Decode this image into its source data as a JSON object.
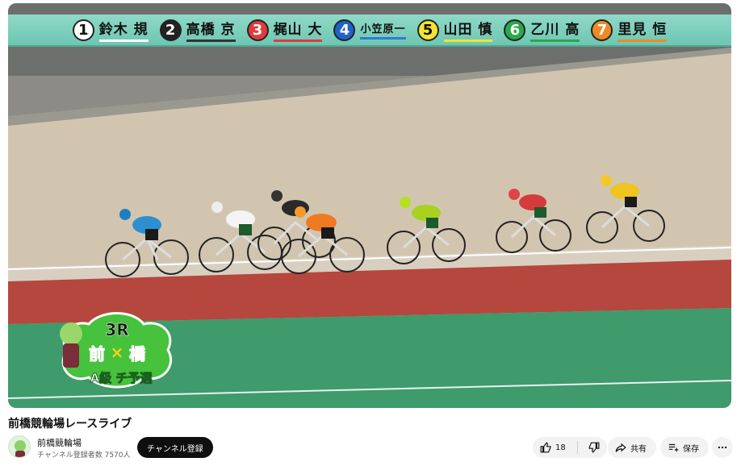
{
  "video": {
    "riders": [
      {
        "number": "1",
        "name": "鈴木 規",
        "bg": "#ffffff",
        "fg": "#111111",
        "line": "#ffffff"
      },
      {
        "number": "2",
        "name": "高橋 京",
        "bg": "#222222",
        "fg": "#ffffff",
        "line": "#333333"
      },
      {
        "number": "3",
        "name": "梶山 大",
        "bg": "#e23a3a",
        "fg": "#ffffff",
        "line": "#e23a3a"
      },
      {
        "number": "4",
        "name": "小笠原一",
        "bg": "#1f62c9",
        "fg": "#ffffff",
        "line": "#2f7ad8"
      },
      {
        "number": "5",
        "name": "山田 慎",
        "bg": "#f4e431",
        "fg": "#111111",
        "line": "#f4e431"
      },
      {
        "number": "6",
        "name": "乙川 高",
        "bg": "#2aa84a",
        "fg": "#ffffff",
        "line": "#2aa84a"
      },
      {
        "number": "7",
        "name": "里見 恒",
        "bg": "#f08a24",
        "fg": "#ffffff",
        "line": "#f08a24"
      }
    ],
    "badge": {
      "race": "3R",
      "venue_left": "前",
      "venue_right": "橋",
      "class_text": "A級 チ予選"
    }
  },
  "meta": {
    "title": "前橋競輪場レースライブ",
    "channel_name": "前橋競輪場",
    "subscribers": "チャンネル登録者数 7570人",
    "subscribe_label": "チャンネル登録",
    "like_count": "18",
    "share_label": "共有",
    "save_label": "保存"
  },
  "icons": {
    "like": "thumbs-up-icon",
    "dislike": "thumbs-down-icon",
    "share": "share-arrow-icon",
    "save": "save-playlist-icon",
    "more": "more-horizontal-icon"
  },
  "colors": {
    "banner": "#7fd0bd",
    "track_red": "#b5473f",
    "infield_green": "#3f9a6c",
    "subscribe_bg": "#0f0f0f"
  }
}
